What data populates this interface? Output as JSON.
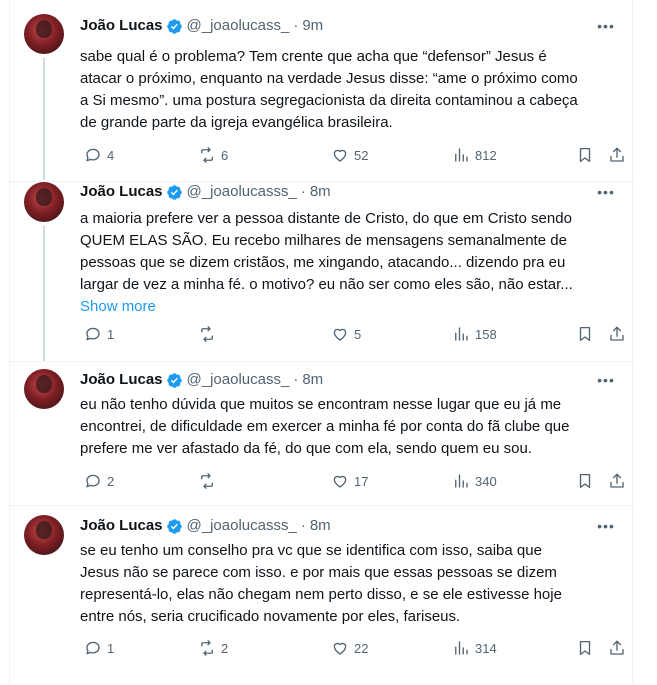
{
  "colors": {
    "accent": "#1d9bf0",
    "secondary_text": "#536471",
    "verified": "#1d9bf0"
  },
  "tweets": [
    {
      "name": "João Lucas",
      "handle": "@_joaolucass_",
      "time": "9m",
      "text": "sabe qual é o problema? Tem crente que acha que “defensor” Jesus é\natacar o próximo, enquanto na verdade Jesus disse: “ame o próximo como\na Si mesmo”. uma postura segregacionista da direita contaminou a cabeça\nde grande parte da igreja evangélica brasileira.",
      "show_more": "",
      "replies": "4",
      "retweets": "6",
      "likes": "52",
      "views": "812"
    },
    {
      "name": "João Lucas",
      "handle": "@_joaolucasss_",
      "time": "8m",
      "text": "a maioria prefere ver a pessoa distante de Cristo, do que em Cristo sendo\nQUEM ELAS SÃO. Eu recebo milhares de mensagens semanalmente de\npessoas que se dizem cristãos, me xingando, atacando... dizendo pra eu\nlargar de vez a minha fé. o motivo? eu não ser como eles são, não estar...",
      "show_more": "Show more",
      "replies": "1",
      "retweets": "",
      "likes": "5",
      "views": "158"
    },
    {
      "name": "João Lucas",
      "handle": "@_joaolucass_",
      "time": "8m",
      "text": "eu não tenho dúvida que muitos se encontram nesse lugar que eu já me\nencontrei, de dificuldade em exercer a minha fé por conta do fã clube que\nprefere me ver afastado da fé, do que com ela, sendo quem eu sou.",
      "show_more": "",
      "replies": "2",
      "retweets": "",
      "likes": "17",
      "views": "340"
    },
    {
      "name": "João Lucas",
      "handle": "@_joaolucasss_",
      "time": "8m",
      "text": "se eu tenho um conselho pra vc que se identifica com isso, saiba que\nJesus não se parece com isso. e por mais que essas pessoas se dizem\nrepresentá-lo, elas não chegam nem perto disso, e se ele estivesse hoje\nentre nós, seria crucificado novamente por eles, fariseus.",
      "show_more": "",
      "replies": "1",
      "retweets": "2",
      "likes": "22",
      "views": "314"
    }
  ]
}
